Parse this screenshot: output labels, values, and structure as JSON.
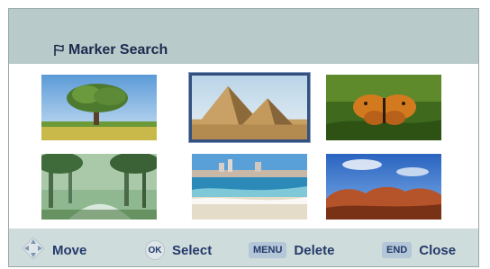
{
  "title": "Marker Search",
  "thumbnails": [
    {
      "icon": "tree-landscape-thumbnail",
      "selected": false
    },
    {
      "icon": "pyramids-thumbnail",
      "selected": true
    },
    {
      "icon": "butterfly-thumbnail",
      "selected": false
    },
    {
      "icon": "forest-stream-thumbnail",
      "selected": false
    },
    {
      "icon": "beach-thumbnail",
      "selected": false
    },
    {
      "icon": "red-rocks-thumbnail",
      "selected": false
    }
  ],
  "controls": {
    "move_label": "Move",
    "ok_key": "OK",
    "select_label": "Select",
    "menu_key": "MENU",
    "delete_label": "Delete",
    "end_key": "END",
    "close_label": "Close"
  },
  "colors": {
    "header": "#b9caca",
    "panel": "#cfdcdc",
    "selection_border": "#33507e",
    "text": "#243a6a"
  }
}
